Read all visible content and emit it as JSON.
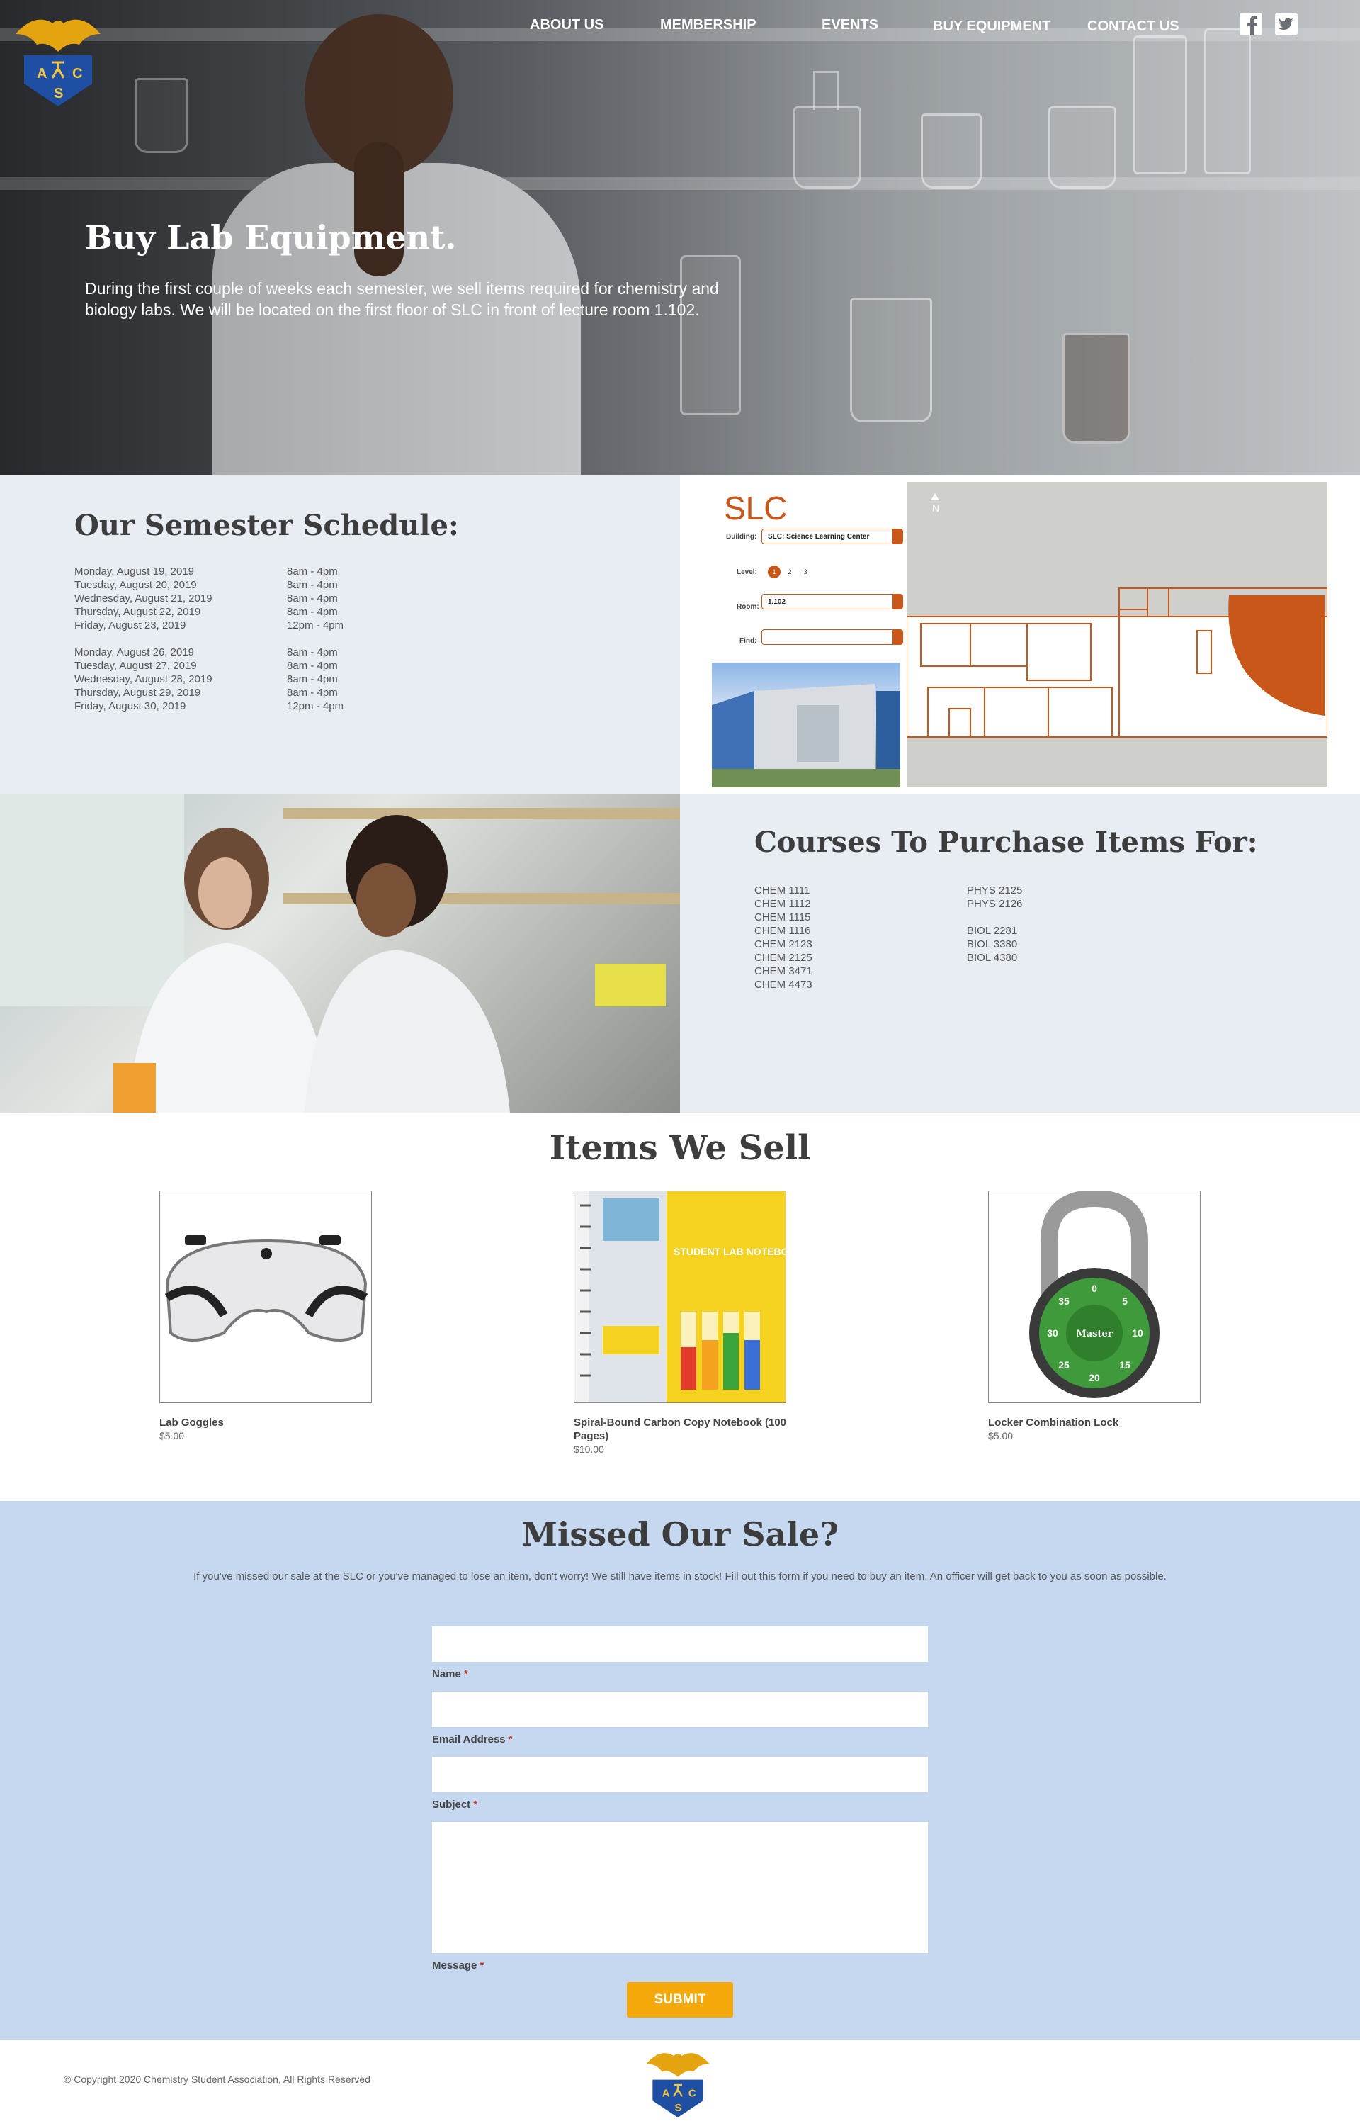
{
  "nav": {
    "items": [
      "ABOUT US",
      "MEMBERSHIP",
      "EVENTS",
      "BUY EQUIPMENT",
      "CONTACT US"
    ],
    "social": [
      "facebook-icon",
      "twitter-icon"
    ]
  },
  "logo": {
    "letters": [
      "A",
      "C",
      "S"
    ]
  },
  "hero": {
    "title": "Buy Lab Equipment.",
    "text": "During the first couple of weeks each semester, we sell items required for chemistry and biology labs. We will be located on the first floor of SLC in front of lecture room 1.102."
  },
  "schedule": {
    "title": "Our Semester Schedule:",
    "week1": [
      {
        "day": "Monday, August 19, 2019",
        "time": "8am - 4pm"
      },
      {
        "day": "Tuesday, August 20, 2019",
        "time": "8am - 4pm"
      },
      {
        "day": "Wednesday, August 21, 2019",
        "time": "8am - 4pm"
      },
      {
        "day": "Thursday, August 22, 2019",
        "time": "8am - 4pm"
      },
      {
        "day": "Friday, August 23, 2019",
        "time": "12pm - 4pm"
      }
    ],
    "week2": [
      {
        "day": "Monday, August 26, 2019",
        "time": "8am - 4pm"
      },
      {
        "day": "Tuesday, August 27, 2019",
        "time": "8am - 4pm"
      },
      {
        "day": "Wednesday, August 28, 2019",
        "time": "8am - 4pm"
      },
      {
        "day": "Thursday, August 29, 2019",
        "time": "8am - 4pm"
      },
      {
        "day": "Friday, August 30, 2019",
        "time": "12pm - 4pm"
      }
    ]
  },
  "map": {
    "logo": "SLC",
    "building_label": "Building:",
    "building_value": "SLC: Science Learning Center",
    "level_label": "Level:",
    "levels": [
      "1",
      "2",
      "3"
    ],
    "room_label": "Room:",
    "room_value": "1.102",
    "find_label": "Find:",
    "find_value": "",
    "north": "N",
    "accent": "#c9571a"
  },
  "courses": {
    "title": "Courses To Purchase Items For:",
    "col1": [
      "CHEM 1111",
      "CHEM 1112",
      "CHEM 1115",
      "CHEM 1116",
      "CHEM 2123",
      "CHEM 2125",
      "CHEM 3471",
      "CHEM 4473"
    ],
    "col2a": [
      "PHYS 2125",
      "PHYS 2126"
    ],
    "col2b": [
      "BIOL 2281",
      "BIOL 3380",
      "BIOL 4380"
    ]
  },
  "items": {
    "title": "Items We Sell",
    "products": [
      {
        "name": "Lab Goggles",
        "price": "$5.00"
      },
      {
        "name": "Spiral-Bound Carbon Copy Notebook (100 Pages)",
        "price": "$10.00",
        "cover_text": "STUDENT LAB NOTEBOOK"
      },
      {
        "name": "Locker Combination Lock",
        "price": "$5.00",
        "brand": "Master",
        "dial": [
          "0",
          "5",
          "10",
          "15",
          "20",
          "25",
          "30",
          "35"
        ]
      }
    ]
  },
  "missed": {
    "title": "Missed Our Sale?",
    "text": "If you've missed our sale at the SLC or you've managed to lose an item, don't worry! We still have items in stock! Fill out this form if you need to buy an item. An officer will get back to you as soon as possible.",
    "fields": [
      "Name",
      "Email Address",
      "Subject",
      "Message"
    ],
    "required_mark": "*",
    "submit": "SUBMIT"
  },
  "footer": {
    "copyright": "© Copyright 2020 Chemistry Student Association, All Rights Reserved"
  },
  "colors": {
    "gold": "#f5a80a",
    "navy": "#1f4fa3",
    "panel": "#e7edf3",
    "form_bg": "#c6d8f0"
  }
}
